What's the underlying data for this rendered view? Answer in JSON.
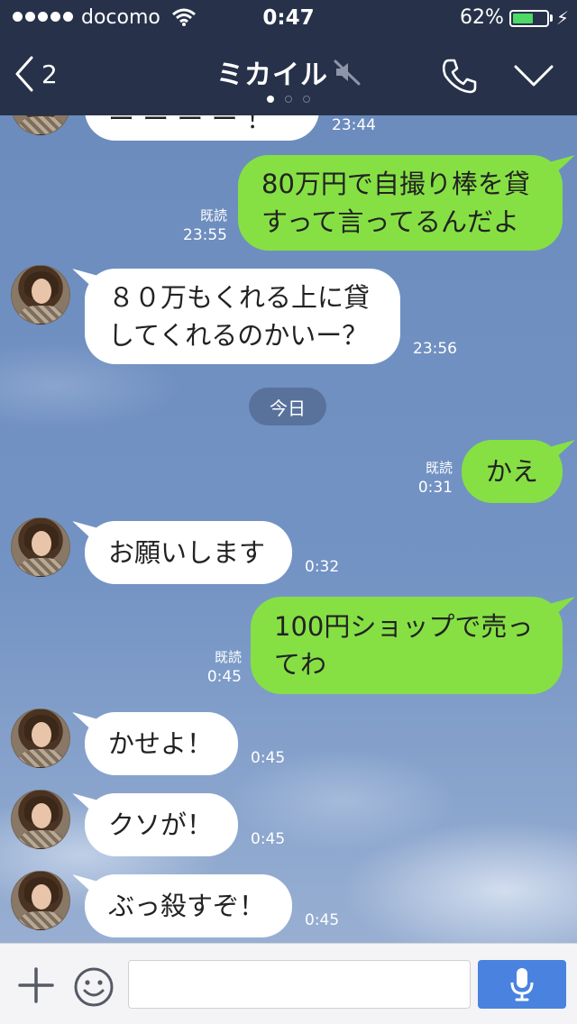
{
  "status_bar": {
    "carrier": "docomo",
    "time": "0:47",
    "battery_percent": "62%",
    "battery_level": 0.62,
    "battery_color": "#4cd964"
  },
  "nav": {
    "back_count": "2",
    "title": "ミカイル",
    "muted_icon": "speaker-muted-icon",
    "call_icon": "phone-icon",
    "menu_icon": "chevron-down-icon",
    "page_dots": {
      "count": 3,
      "active_index": 0,
      "active_color": "#ffffff",
      "inactive_color": "#6f7a92"
    }
  },
  "chat": {
    "partial_top": {
      "text": "ー ー ー ー ！",
      "time": "23:44"
    },
    "messages": [
      {
        "from": "me",
        "lines": [
          "80万円で自撮り棒を貸",
          "すって言ってるんだよ"
        ],
        "read": "既読",
        "time": "23:55"
      },
      {
        "from": "them",
        "lines": [
          "８０万もくれる上に貸",
          "してくれるのかいー？"
        ],
        "time": "23:56"
      },
      {
        "from": "me",
        "lines": [
          "かえ"
        ],
        "read": "既読",
        "time": "0:31"
      },
      {
        "from": "them",
        "lines": [
          "お願いします"
        ],
        "time": "0:32"
      },
      {
        "from": "me",
        "lines": [
          "100円ショップで売っ",
          "てわ"
        ],
        "read": "既読",
        "time": "0:45"
      },
      {
        "from": "them",
        "lines": [
          "かせよ！"
        ],
        "time": "0:45"
      },
      {
        "from": "them",
        "lines": [
          "クソが！"
        ],
        "time": "0:45"
      },
      {
        "from": "them",
        "lines": [
          "ぶっ殺すぞ！"
        ],
        "time": "0:45"
      }
    ],
    "date_separator": "今日",
    "bubble_colors": {
      "incoming": "#ffffff",
      "outgoing": "#86e044"
    }
  },
  "input_bar": {
    "plus_icon": "plus-icon",
    "emoji_icon": "emoji-icon",
    "mic_icon": "microphone-icon",
    "input_value": "",
    "mic_color": "#4a82e0"
  }
}
